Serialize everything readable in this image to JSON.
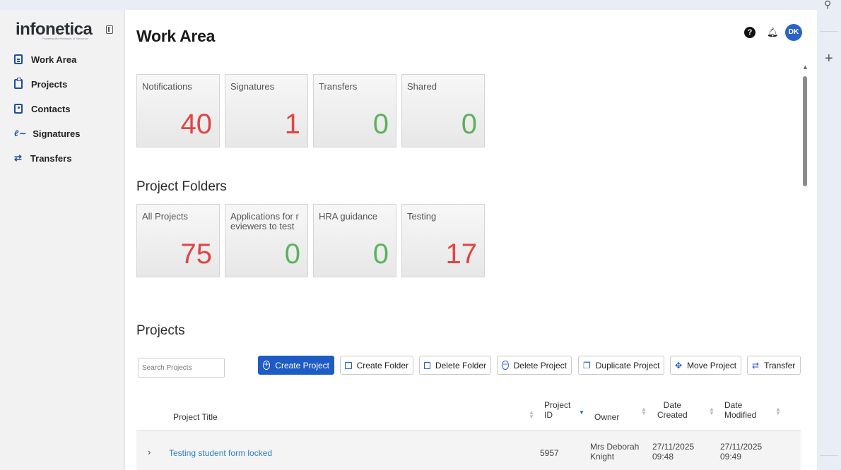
{
  "app": {
    "logo": "infonetica",
    "tagline": "Powering the Research of Tomorrow",
    "page_title": "Work Area",
    "avatar_initials": "DK",
    "help_glyph": "?"
  },
  "sidebar": {
    "items": [
      {
        "label": "Work Area",
        "icon": "document-icon"
      },
      {
        "label": "Projects",
        "icon": "clipboard-icon"
      },
      {
        "label": "Contacts",
        "icon": "contact-card-icon"
      },
      {
        "label": "Signatures",
        "icon": "signature-icon"
      },
      {
        "label": "Transfers",
        "icon": "transfer-arrows-icon"
      }
    ]
  },
  "summary_tiles": [
    {
      "label": "Notifications",
      "value": "40",
      "color": "#e04545"
    },
    {
      "label": "Signatures",
      "value": "1",
      "color": "#e04545"
    },
    {
      "label": "Transfers",
      "value": "0",
      "color": "#5bb25b"
    },
    {
      "label": "Shared",
      "value": "0",
      "color": "#5bb25b"
    }
  ],
  "folders": {
    "title": "Project Folders",
    "tiles": [
      {
        "label": "All Projects",
        "value": "75",
        "color": "#e04545"
      },
      {
        "label": "Applications for r eviewers to test",
        "value": "0",
        "color": "#5bb25b"
      },
      {
        "label": "HRA guidance",
        "value": "0",
        "color": "#5bb25b"
      },
      {
        "label": "Testing",
        "value": "17",
        "color": "#e04545"
      }
    ]
  },
  "projects": {
    "title": "Projects",
    "search_placeholder": "Search Projects",
    "buttons": {
      "create_project": "Create Project",
      "create_folder": "Create Folder",
      "delete_folder": "Delete Folder",
      "delete_project": "Delete Project",
      "duplicate_project": "Duplicate Project",
      "move_project": "Move Project",
      "transfer": "Transfer"
    },
    "columns": {
      "title": "Project Title",
      "id_line1": "Project",
      "id_line2": "ID",
      "owner": "Owner",
      "created_line1": "Date",
      "created_line2": "Created",
      "modified_line1": "Date",
      "modified_line2": "Modified"
    },
    "rows": [
      {
        "title": "Testing student form locked",
        "id": "5957",
        "owner_line1": "Mrs Deborah",
        "owner_line2": "Knight",
        "created_date": "27/11/2025",
        "created_time": "09:48",
        "modified_date": "27/11/2025",
        "modified_time": "09:49"
      }
    ]
  }
}
